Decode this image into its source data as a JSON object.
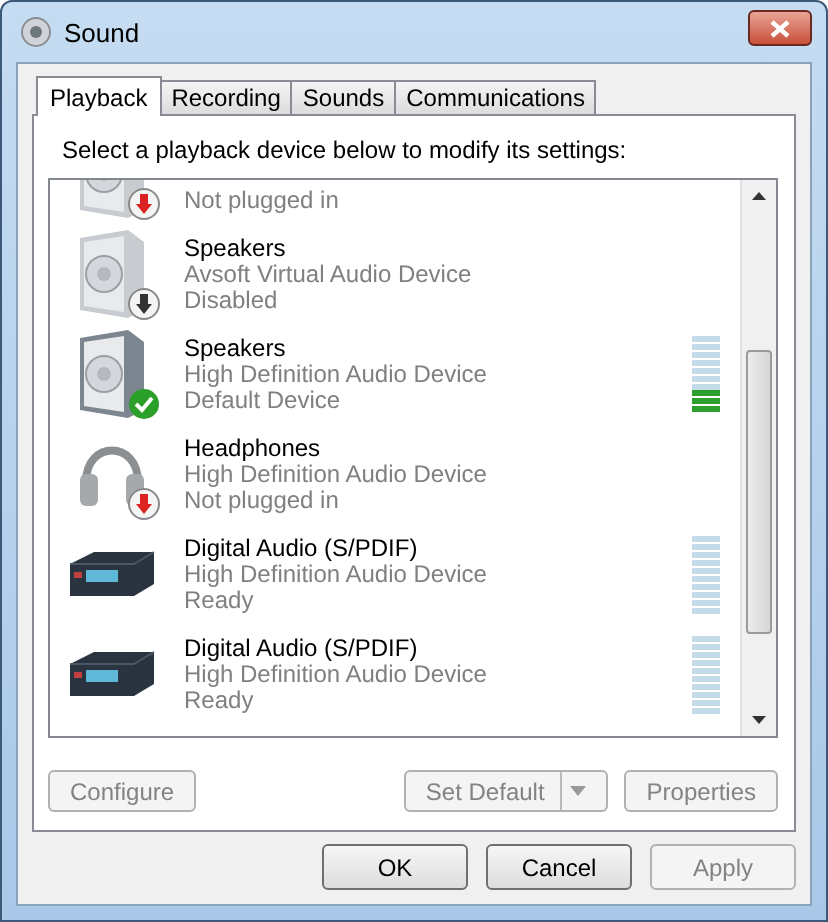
{
  "window": {
    "title": "Sound"
  },
  "tabs": [
    {
      "label": "Playback",
      "selected": true
    },
    {
      "label": "Recording",
      "selected": false
    },
    {
      "label": "Sounds",
      "selected": false
    },
    {
      "label": "Communications",
      "selected": false
    }
  ],
  "instruction": "Select a playback device below to modify its settings:",
  "devices": [
    {
      "kind": "speaker",
      "default": false,
      "disabled": false,
      "unplugged": true,
      "status": "Not plugged in",
      "selected": false
    },
    {
      "kind": "speaker",
      "default": false,
      "disabled": true,
      "unplugged": false,
      "name": "Speakers",
      "driver": "Avsoft Virtual Audio Device",
      "status": "Disabled",
      "selected": false
    },
    {
      "kind": "speaker",
      "default": true,
      "disabled": false,
      "unplugged": false,
      "name": "Speakers",
      "driver": "High Definition Audio Device",
      "status": "Default Device",
      "level": 0.3,
      "selected": false
    },
    {
      "kind": "headphones",
      "default": false,
      "disabled": false,
      "unplugged": true,
      "name": "Headphones",
      "driver": "High Definition Audio Device",
      "status": "Not plugged in",
      "selected": false
    },
    {
      "kind": "digital",
      "default": false,
      "disabled": false,
      "unplugged": false,
      "name": "Digital Audio (S/PDIF)",
      "driver": "High Definition Audio Device",
      "status": "Ready",
      "level": 0,
      "selected": false
    },
    {
      "kind": "digital",
      "default": false,
      "disabled": false,
      "unplugged": false,
      "name": "Digital Audio (S/PDIF)",
      "driver": "High Definition Audio Device",
      "status": "Ready",
      "level": 0,
      "selected": false
    }
  ],
  "panel_buttons": [
    {
      "label": "Configure",
      "disabled": true
    },
    {
      "label": "Set Default",
      "disabled": true,
      "dropdown": true
    },
    {
      "label": "Properties",
      "disabled": true
    }
  ],
  "dialog_buttons": [
    {
      "label": "OK",
      "disabled": false
    },
    {
      "label": "Cancel",
      "disabled": false
    },
    {
      "label": "Apply",
      "disabled": true
    }
  ]
}
